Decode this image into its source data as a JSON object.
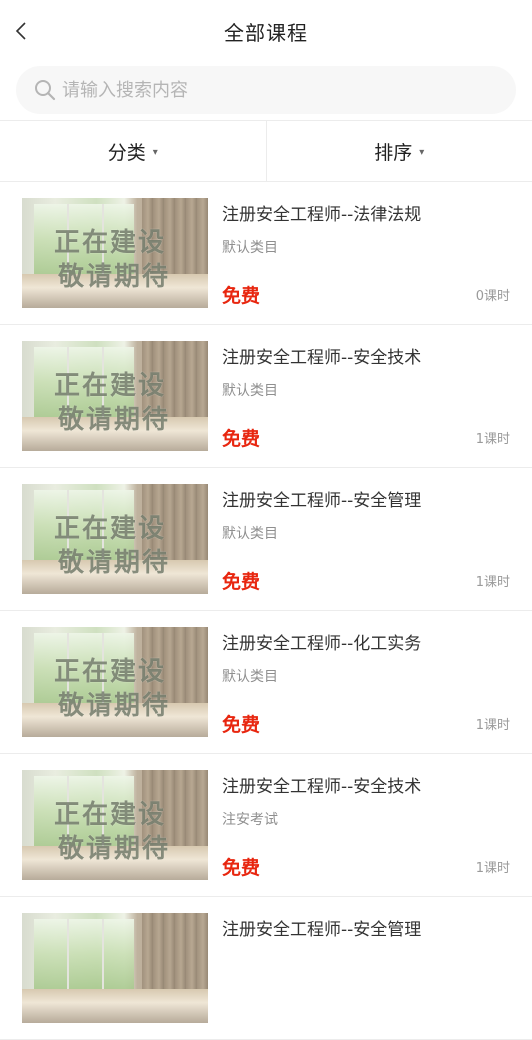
{
  "header": {
    "title": "全部课程",
    "back_icon": "chevron-left-icon"
  },
  "search": {
    "placeholder": "请输入搜索内容",
    "value": ""
  },
  "filters": [
    {
      "label": "分类"
    },
    {
      "label": "排序"
    }
  ],
  "courses": [
    {
      "title": "注册安全工程师--法律法规",
      "category": "默认类目",
      "price": "免费",
      "lessons": "0课时",
      "thumb_text_1": "正在建设",
      "thumb_text_2": "敬请期待"
    },
    {
      "title": "注册安全工程师--安全技术",
      "category": "默认类目",
      "price": "免费",
      "lessons": "1课时",
      "thumb_text_1": "正在建设",
      "thumb_text_2": "敬请期待"
    },
    {
      "title": "注册安全工程师--安全管理",
      "category": "默认类目",
      "price": "免费",
      "lessons": "1课时",
      "thumb_text_1": "正在建设",
      "thumb_text_2": "敬请期待"
    },
    {
      "title": "注册安全工程师--化工实务",
      "category": "默认类目",
      "price": "免费",
      "lessons": "1课时",
      "thumb_text_1": "正在建设",
      "thumb_text_2": "敬请期待"
    },
    {
      "title": "注册安全工程师--安全技术",
      "category": "注安考试",
      "price": "免费",
      "lessons": "1课时",
      "thumb_text_1": "正在建设",
      "thumb_text_2": "敬请期待"
    },
    {
      "title": "注册安全工程师--安全管理",
      "category": "",
      "price": "",
      "lessons": "",
      "thumb_text_1": "",
      "thumb_text_2": ""
    }
  ],
  "colors": {
    "price": "#e8260f",
    "muted": "#9a9a9a",
    "title": "#222222"
  }
}
